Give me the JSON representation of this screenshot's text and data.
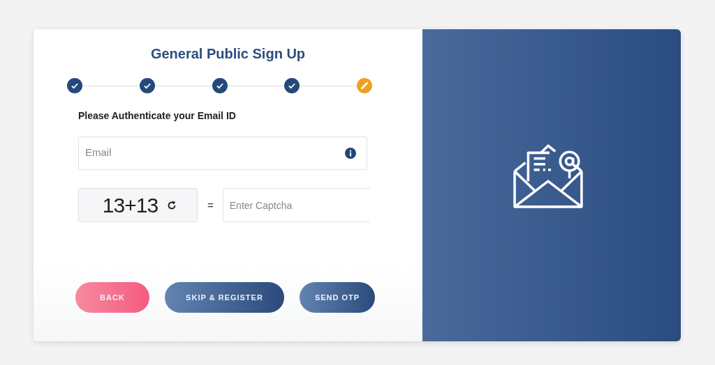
{
  "form": {
    "title": "General Public Sign Up",
    "steps": [
      {
        "kind": "done"
      },
      {
        "kind": "done"
      },
      {
        "kind": "done"
      },
      {
        "kind": "done"
      },
      {
        "kind": "current"
      }
    ],
    "prompt": "Please Authenticate your Email ID",
    "email": {
      "placeholder": "Email"
    },
    "captcha": {
      "question": "13+13",
      "equals": "=",
      "placeholder": "Enter Captcha"
    },
    "buttons": [
      {
        "label": "BACK",
        "kind": "secondary"
      },
      {
        "label": "SKIP & REGISTER",
        "kind": "primary"
      },
      {
        "label": "SEND OTP",
        "kind": "primary"
      }
    ]
  }
}
